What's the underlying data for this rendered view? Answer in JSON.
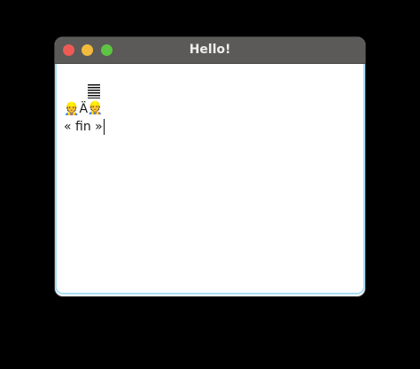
{
  "window": {
    "title": "Hello!"
  },
  "editor": {
    "line2_emoji": "👷",
    "line3_emoji": "👷",
    "line3_text": "Ä",
    "line4_text": "« fin »"
  },
  "icons": {
    "line1": "horizontal-lines-glyph"
  },
  "colors": {
    "close": "#ee5b55",
    "minimize": "#f2bb3c",
    "zoom": "#5ec444",
    "titlebar": "#5b5a58",
    "focus_border": "#a9dff5"
  }
}
